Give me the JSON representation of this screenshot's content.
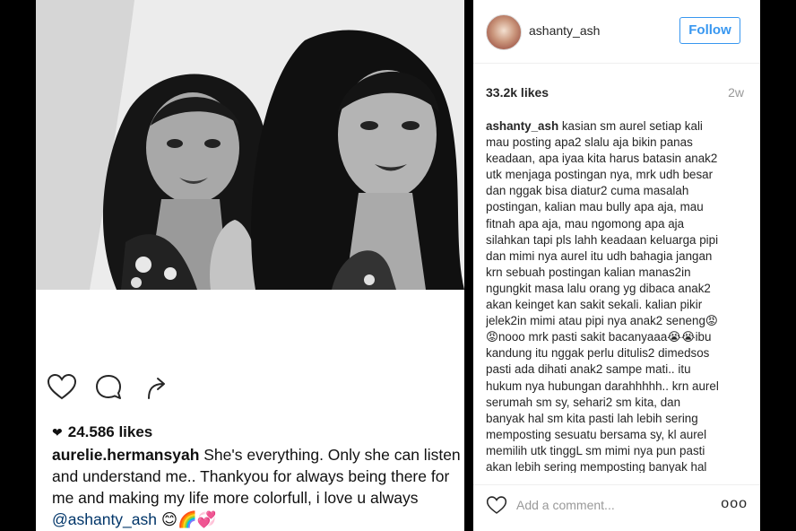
{
  "post_left": {
    "likes": "24.586 likes",
    "username": "aurelie.hermansyah",
    "caption": " She's everything. Only she can listen and understand me.. Thankyou for always being there for me and making my life more colorfull, i love u always ",
    "mention": "@ashanty_ash",
    "emojis": " 😊🌈💞",
    "icons": [
      "heart-outline-icon",
      "comment-bubble-icon",
      "share-arrow-icon"
    ]
  },
  "sidebar": {
    "username": "ashanty_ash",
    "follow_label": "Follow",
    "likes": "33.2k likes",
    "age": "2w",
    "comment_username": "ashanty_ash",
    "comment_text": " kasian sm aurel setiap kali\nmau posting apa2 slalu aja bikin panas\nkeadaan, apa iyaa kita harus batasin anak2\nutk menjaga postingan nya, mrk udh besar\ndan nggak bisa diatur2 cuma masalah\npostingan, kalian mau bully apa aja, mau\nfitnah apa aja, mau ngomong apa aja\nsilahkan tapi pls lahh keadaan keluarga pipi\ndan mimi nya aurel itu udh bahagia jangan\nkrn sebuah postingan kalian manas2in\nngungkit masa lalu orang yg dibaca anak2\nakan keinget kan sakit sekali. kalian pikir\njelek2in mimi atau pipi nya anak2 seneng😡\n😡nooo mrk pasti sakit bacanyaaa😭😭ibu\nkandung itu nggak perlu ditulis2 dimedsos\npasti ada dihati anak2 sampe mati.. itu\nhukum nya hubungan darahhhhh.. krn aurel\nserumah sm sy, sehari2 sm kita, dan\nbanyak hal sm kita pasti lah lebih sering\nmemposting sesuatu bersama sy, kl aurel\nmemilih utk tinggL sm mimi nya pun pasti\nakan lebih sering memposting banyak hal",
    "add_comment_placeholder": "Add a comment...",
    "more_label": "ooo"
  },
  "colors": {
    "follow_blue": "#3897f0",
    "text_dark": "#262626",
    "text_muted": "#999999",
    "mention_link": "#003569"
  }
}
